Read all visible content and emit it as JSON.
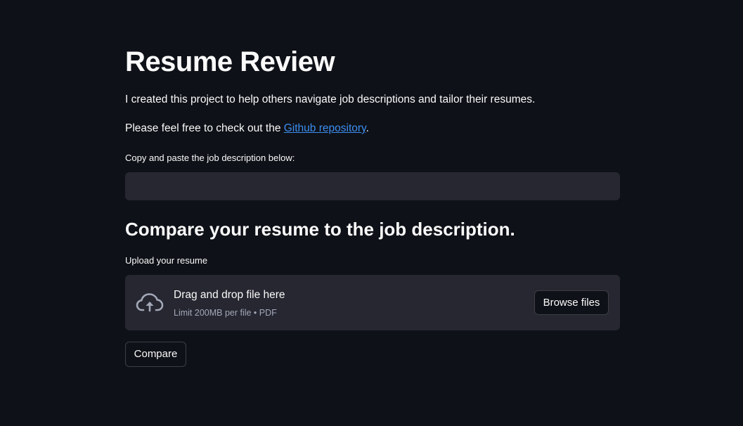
{
  "page": {
    "title": "Resume Review",
    "intro": "I created this project to help others navigate job descriptions and tailor their resumes.",
    "repo_prefix": "Please feel free to check out the ",
    "repo_link": "Github repository",
    "repo_suffix": "."
  },
  "job_description": {
    "label": "Copy and paste the job description below:",
    "value": ""
  },
  "compare_section": {
    "heading": "Compare your resume to the job description."
  },
  "uploader": {
    "label": "Upload your resume",
    "drop_text": "Drag and drop file here",
    "limit_text": "Limit 200MB per file • PDF",
    "browse_label": "Browse files",
    "icon": "cloud-upload-icon"
  },
  "actions": {
    "compare_label": "Compare"
  },
  "theme": {
    "background": "#0e1117",
    "surface": "#262730",
    "text": "#fafafa",
    "link": "#3d8ef0",
    "muted": "#a3a8b8"
  }
}
